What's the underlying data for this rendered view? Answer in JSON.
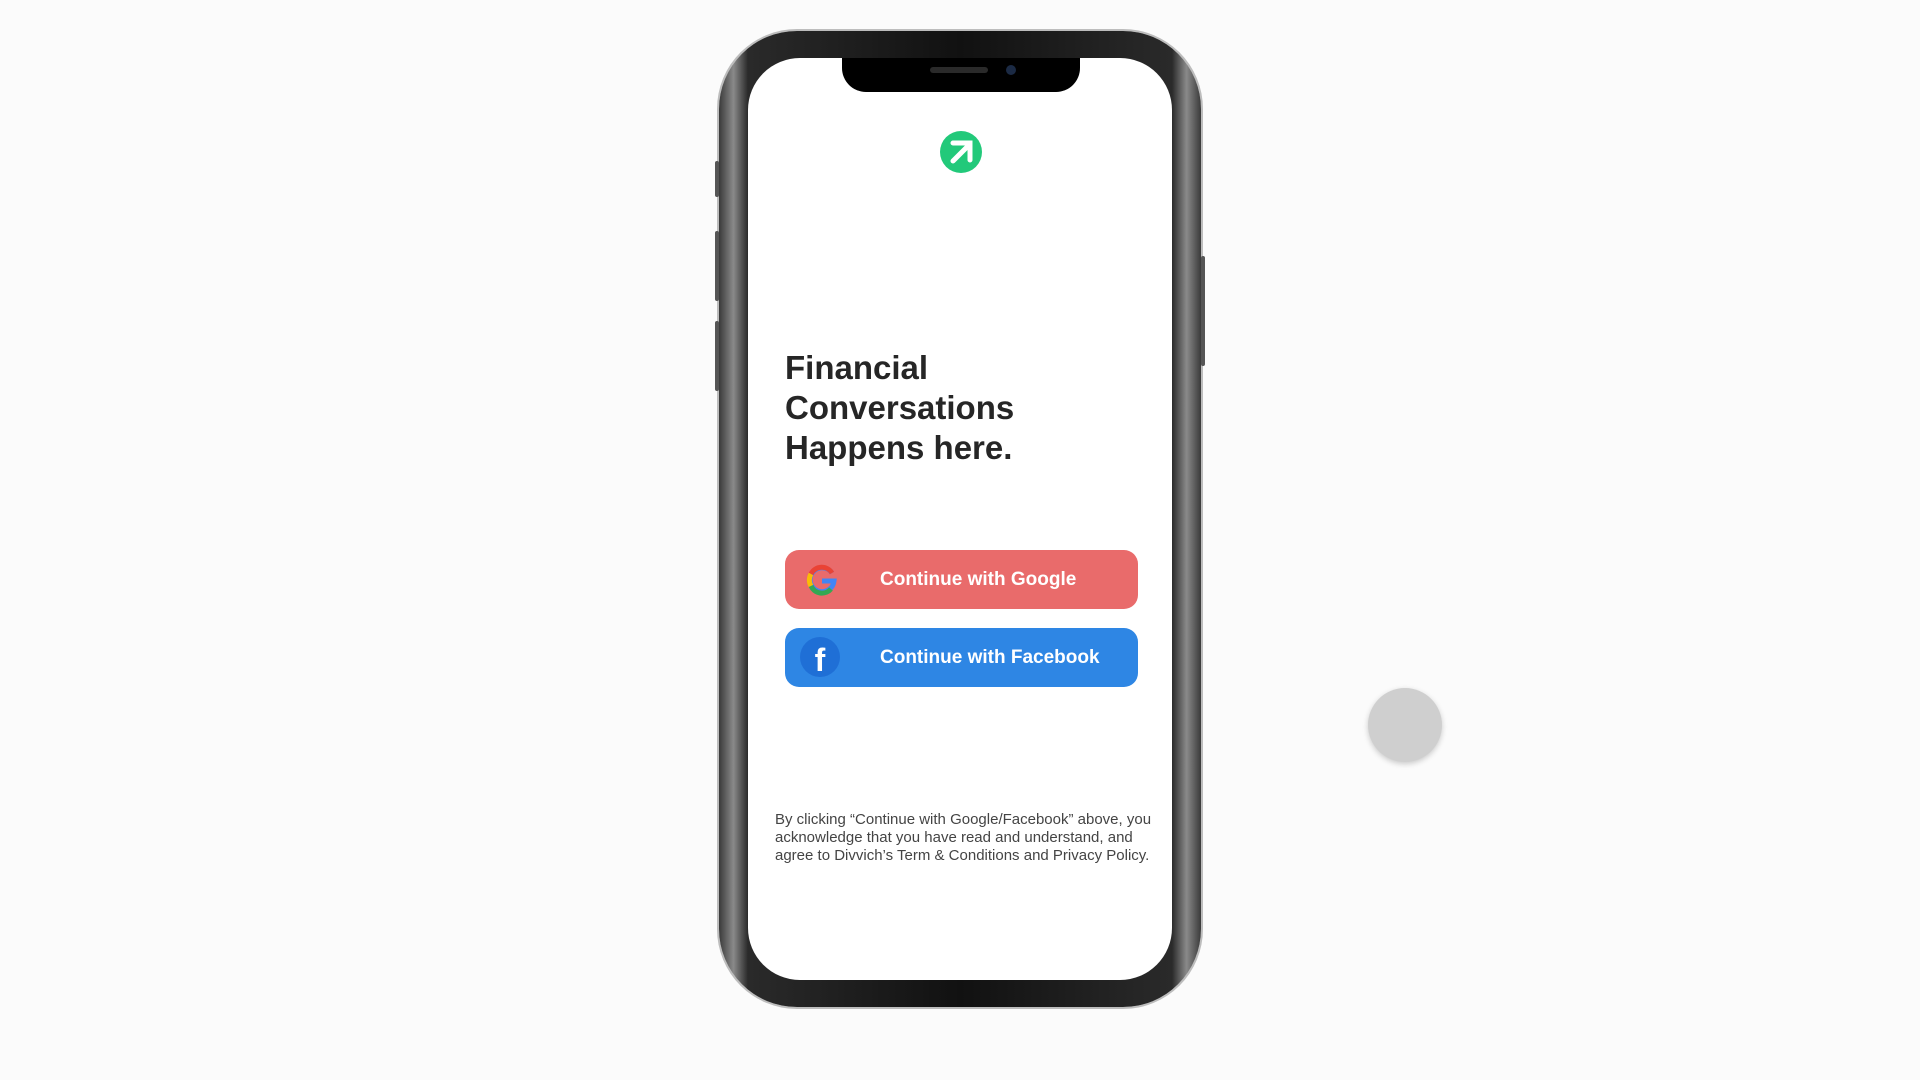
{
  "colors": {
    "logo": "#22c97a",
    "google_button": "#e96b6b",
    "facebook_button": "#2e86e4"
  },
  "login": {
    "headline_line1": "Financial Conversations",
    "headline_line2": "Happens here.",
    "google_label": "Continue with Google",
    "facebook_label": "Continue with Facebook",
    "facebook_icon_glyph": "f",
    "disclaimer": "By clicking “Continue with Google/Facebook” above, you acknowledge that you have read and understand, and agree to Divvich’s Term & Conditions and Privacy Policy."
  },
  "icons": {
    "logo": "arrow-up-right-logo-icon",
    "google": "google-icon",
    "facebook": "facebook-icon"
  }
}
